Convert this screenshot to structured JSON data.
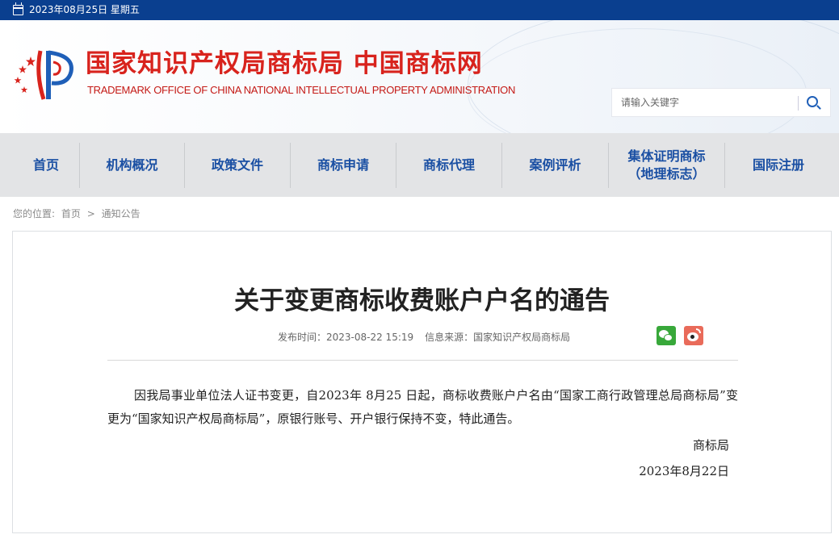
{
  "topbar": {
    "calendar_icon": "calendar-icon",
    "date_text": "2023年08月25日 星期五"
  },
  "header": {
    "title": "国家知识产权局商标局 中国商标网",
    "subtitle": "TRADEMARK OFFICE OF CHINA NATIONAL INTELLECTUAL PROPERTY ADMINISTRATION",
    "brand_color": "#d8231d"
  },
  "search": {
    "placeholder": "请输入关键字",
    "icon": "search-icon"
  },
  "nav": {
    "items": [
      {
        "label": "首页"
      },
      {
        "label": "机构概况"
      },
      {
        "label": "政策文件"
      },
      {
        "label": "商标申请"
      },
      {
        "label": "商标代理"
      },
      {
        "label": "案例评析"
      },
      {
        "label": "集体证明商标\n（地理标志）"
      },
      {
        "label": "国际注册"
      }
    ],
    "text_color": "#1a4fa3"
  },
  "breadcrumb": {
    "prefix": "您的位置:",
    "home": "首页",
    "separator": ">",
    "current": "通知公告"
  },
  "article": {
    "title": "关于变更商标收费账户户名的通告",
    "publish_time": "发布时间：2023-08-22 15:19",
    "source": "信息来源：国家知识产权局商标局",
    "share_icons": [
      "wechat-icon",
      "weibo-icon"
    ],
    "body": "因我局事业单位法人证书变更，自2023年 8月25 日起，商标收费账户户名由“国家工商行政管理总局商标局”变更为“国家知识产权局商标局”，原银行账号、开户银行保持不变，特此通告。",
    "signature_org": "商标局",
    "signature_date": "2023年8月22日"
  }
}
